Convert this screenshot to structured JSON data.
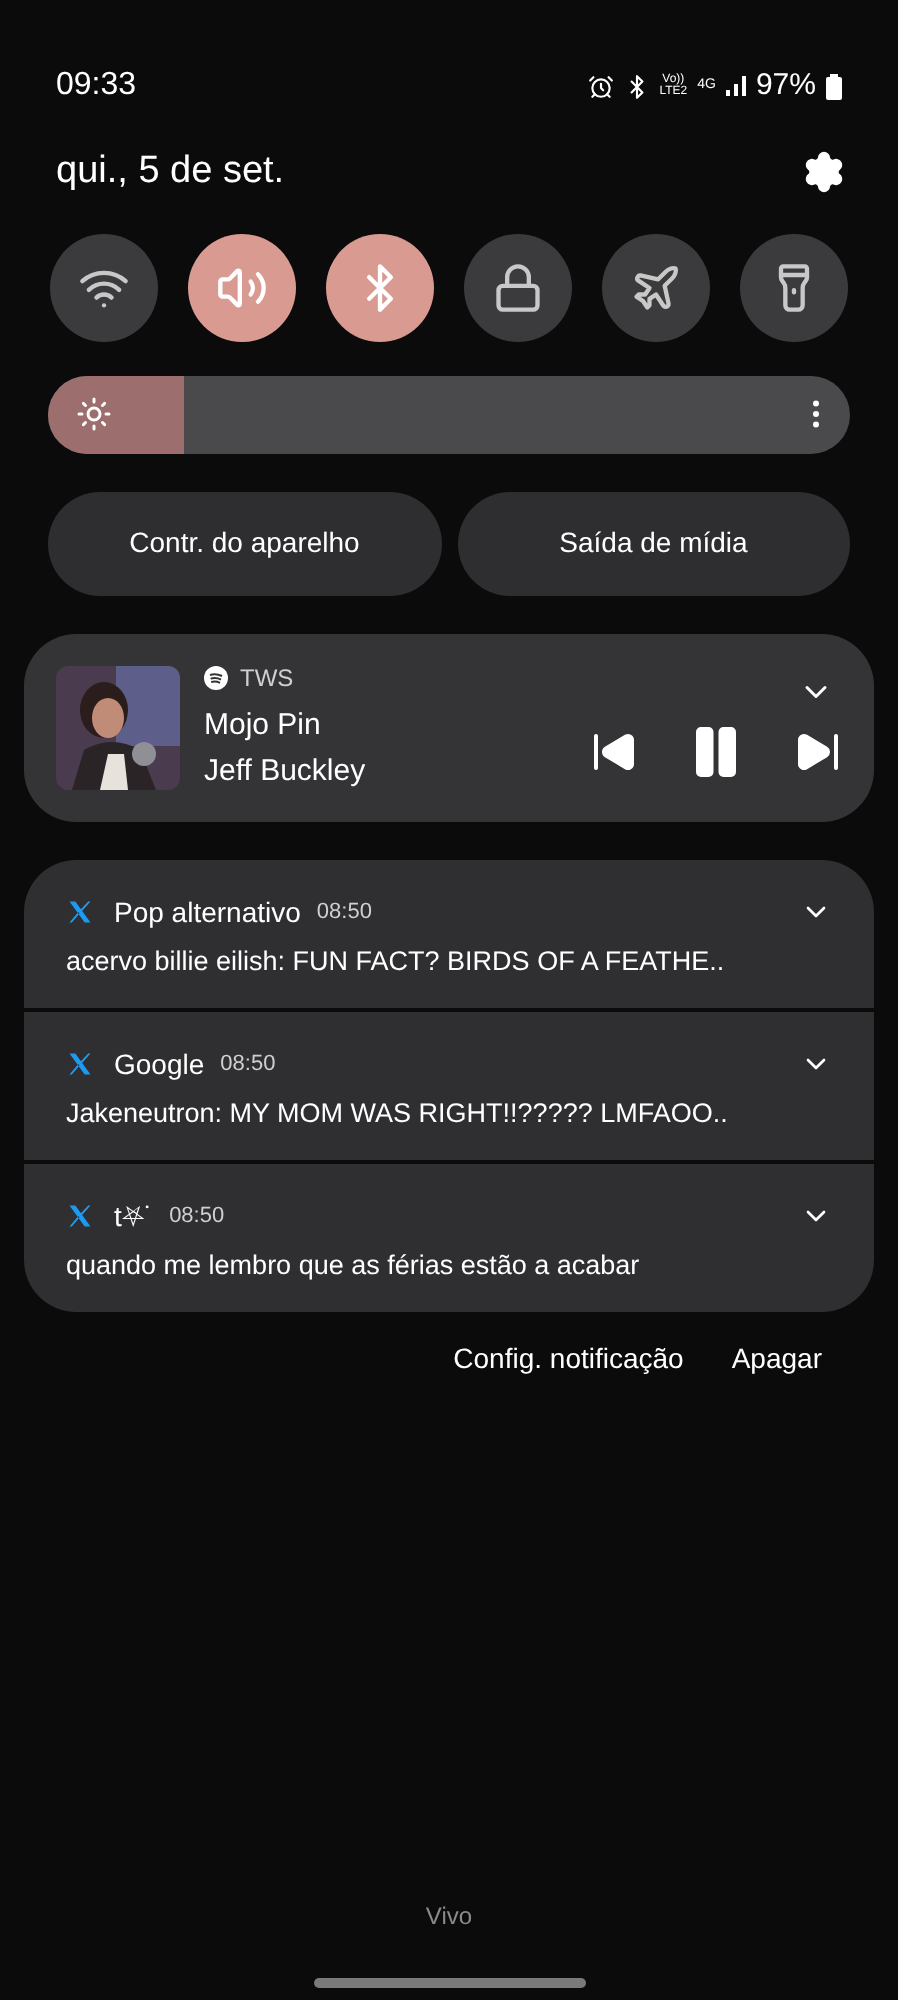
{
  "status_bar": {
    "time": "09:33",
    "volte_top": "Vo))",
    "volte_bottom": "LTE2",
    "network": "4G",
    "battery": "97%"
  },
  "header": {
    "date": "qui., 5 de set."
  },
  "tiles": [
    {
      "kind": "wifi",
      "on": false
    },
    {
      "kind": "sound",
      "on": true
    },
    {
      "kind": "bluetooth",
      "on": true
    },
    {
      "kind": "lock",
      "on": false
    },
    {
      "kind": "airplane",
      "on": false
    },
    {
      "kind": "flashlight",
      "on": false
    }
  ],
  "brightness": {
    "level": 0.17
  },
  "buttons": [
    "Contr. do aparelho",
    "Saída de mídia"
  ],
  "media": {
    "app": "TWS",
    "title": "Mojo Pin",
    "artist": "Jeff Buckley",
    "playing": true
  },
  "notifications": [
    {
      "title": "Pop alternativo",
      "time": "08:50",
      "text": "acervo billie eilish: FUN FACT? BIRDS OF A FEATHE.."
    },
    {
      "title": "Google",
      "time": "08:50",
      "text": "Jakeneutron: MY MOM WAS RIGHT!!????? LMFAOO.."
    },
    {
      "title": "t⛧˙",
      "time": "08:50",
      "text": "quando me lembro que as férias estão a acabar"
    }
  ],
  "actions": [
    "Config. notificação",
    "Apagar"
  ],
  "carrier": "Vivo"
}
